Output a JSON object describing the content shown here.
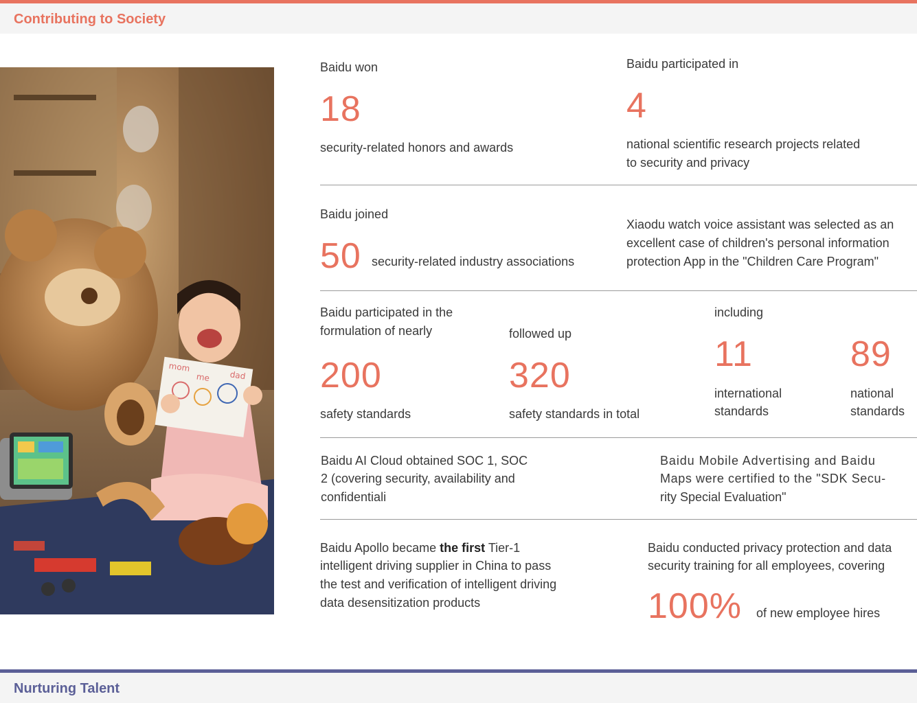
{
  "colors": {
    "accent": "#e8735f",
    "accent2": "#5b5f97",
    "text": "#3a3a3a"
  },
  "top_section": {
    "title": "Contributing to Society"
  },
  "bottom_section": {
    "title": "Nurturing Talent"
  },
  "photo": {
    "drawing_text_mom": "mom",
    "drawing_text_me": "me",
    "drawing_text_dad": "dad"
  },
  "stats": {
    "honors": {
      "lead": "Baidu won",
      "number": "18",
      "desc": "security-related honors and awards"
    },
    "research": {
      "lead": "Baidu participated in",
      "number": "4",
      "desc_line1": "national scientific research projects related",
      "desc_line2": "to security and privacy"
    },
    "associations": {
      "lead": "Baidu joined",
      "number": "50",
      "desc": "security-related industry associations"
    },
    "xiaodu": {
      "line1": "Xiaodu watch voice assistant was selected as an",
      "line2": "excellent case of children's personal information",
      "line3": "protection App in the \"Children Care Program\""
    },
    "formulation": {
      "lead_line1": "Baidu participated in the",
      "lead_line2": "formulation of nearly",
      "number": "200",
      "desc": "safety standards"
    },
    "followed": {
      "lead": "followed up",
      "number": "320",
      "desc": "safety standards in total"
    },
    "including": {
      "lead": "including"
    },
    "international": {
      "number": "11",
      "desc_line1": "international",
      "desc_line2": "standards"
    },
    "national": {
      "number": "89",
      "desc_line1": "national",
      "desc_line2": "standards"
    },
    "soc": {
      "line1": "Baidu AI Cloud obtained SOC 1, SOC",
      "line2": "2 (covering security, availability and",
      "line3": "confidentiali"
    },
    "sdk": {
      "line1": "Baidu Mobile Advertising and Baidu",
      "line2": "Maps were certified to the \"SDK Secu-",
      "line3": "rity Special Evaluation\""
    },
    "apollo": {
      "line1_pre": "Baidu Apollo became ",
      "line1_bold": "the first",
      "line1_post": " Tier-1",
      "line2": "intelligent driving supplier in China to pass",
      "line3": "the test and verification of intelligent driving",
      "line4": "data desensitization products"
    },
    "training": {
      "line1": "Baidu conducted privacy protection and data",
      "line2": "security training for all employees, covering",
      "number": "100%",
      "desc": "of new employee hires"
    }
  }
}
